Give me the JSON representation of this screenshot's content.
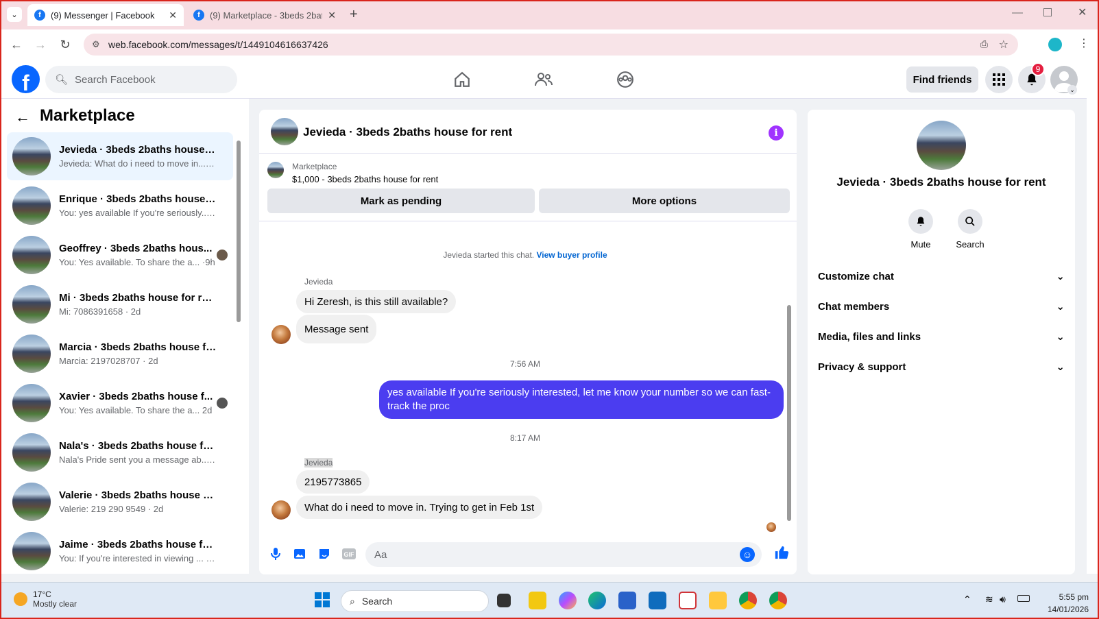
{
  "browser": {
    "tabs": [
      {
        "label": "(9) Messenger | Facebook",
        "active": true
      },
      {
        "label": "(9) Marketplace - 3beds 2baths",
        "active": false
      }
    ],
    "url": "web.facebook.com/messages/t/1449104616637426"
  },
  "fb": {
    "search_placeholder": "Search Facebook",
    "find_friends": "Find friends",
    "notification_count": "9"
  },
  "sidebar": {
    "title": "Marketplace",
    "conversations": [
      {
        "name": "Jevieda · 3beds 2baths house fo...",
        "preview": "Jevieda: What do i need to move in... ·9h"
      },
      {
        "name": "Enrique · 3beds 2baths house fo...",
        "preview": "You: yes available If you're seriously... ·9h"
      },
      {
        "name": "Geoffrey · 3beds 2baths hous...",
        "preview": "You: Yes available. To share the a... ·9h"
      },
      {
        "name": "Mi · 3beds 2baths house for rent",
        "preview": "Mi: 7086391658 · 2d"
      },
      {
        "name": "Marcia · 3beds 2baths house for...",
        "preview": "Marcia: 2197028707 · 2d"
      },
      {
        "name": "Xavier · 3beds 2baths house f...",
        "preview": "You: Yes available. To share the a... 2d"
      },
      {
        "name": "Nala's · 3beds 2baths house for ...",
        "preview": "Nala's Pride sent you a message ab... ·2d"
      },
      {
        "name": "Valerie · 3beds 2baths house for...",
        "preview": "Valerie: 219 290 9549 · 2d"
      },
      {
        "name": "Jaime · 3beds 2baths house for r...",
        "preview": "You: If you're interested in viewing ... ·2d"
      }
    ]
  },
  "chat": {
    "title": "Jevieda · 3beds 2baths house for rent",
    "marketplace_label": "Marketplace",
    "listing": "$1,000 - 3beds 2baths house for rent",
    "mark_pending": "Mark as pending",
    "more_options": "More options",
    "started_text": "Jevieda started this chat.",
    "view_profile": "View buyer profile",
    "sender1": "Jevieda",
    "msg1": "Hi Zeresh, is this still available?",
    "msg2": "Message sent",
    "time1": "7:56 AM",
    "msg3": "yes available If you're seriously interested, let me know your number so we can fast-track the proc",
    "time2": "8:17 AM",
    "sender2": "Jevieda",
    "msg4": "2195773865",
    "msg5": "What do i need to move in. Trying to get in Feb 1st",
    "input_placeholder": "Aa"
  },
  "info": {
    "name": "Jevieda · 3beds 2baths house for rent",
    "mute": "Mute",
    "search": "Search",
    "sections": [
      "Customize chat",
      "Chat members",
      "Media, files and links",
      "Privacy & support"
    ]
  },
  "taskbar": {
    "temp": "17°C",
    "weather": "Mostly clear",
    "search": "Search",
    "time": "5:55 pm",
    "date": "14/01/2026"
  },
  "colors": {
    "fb_blue": "#0866ff",
    "my_bubble": "#4b3df0"
  }
}
